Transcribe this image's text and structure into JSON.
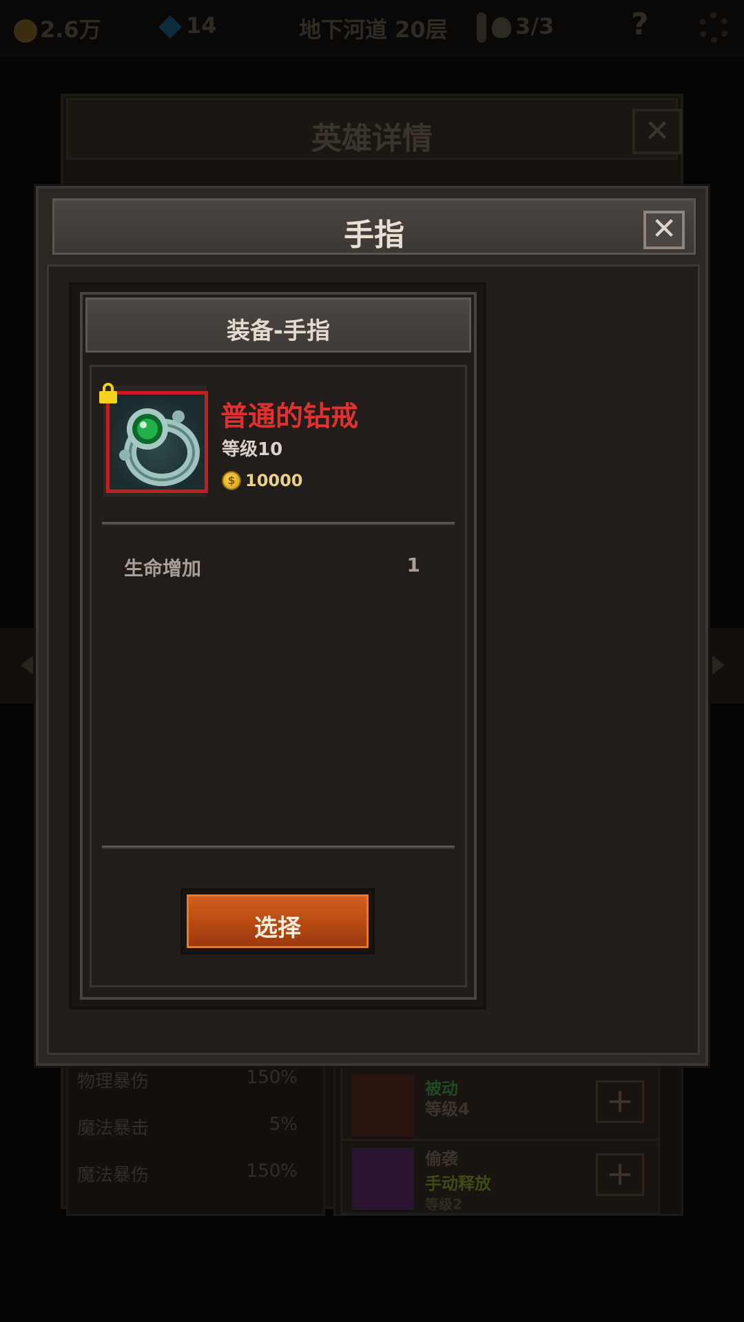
{
  "topbar": {
    "gold": "2.6万",
    "gems": "14",
    "location": "地下河道 20层",
    "keys": "3/3",
    "help": "?"
  },
  "hero_details": {
    "title": "英雄详情",
    "close": "✕",
    "stats": [
      {
        "label": "物理暴伤",
        "value": "150%"
      },
      {
        "label": "魔法暴击",
        "value": "5%"
      },
      {
        "label": "魔法暴伤",
        "value": "150%"
      }
    ],
    "skills": [
      {
        "type": "被动",
        "level": "等级4"
      },
      {
        "name": "偷袭",
        "type": "手动释放",
        "level": "等级2"
      }
    ]
  },
  "dialog": {
    "title": "手指",
    "close": "✕"
  },
  "equip": {
    "header": "装备-手指",
    "item_name": "普通的钻戒",
    "item_level": "等级10",
    "item_price": "10000",
    "attributes": [
      {
        "label": "生命增加",
        "value": "1"
      }
    ],
    "select_label": "选择"
  },
  "colors": {
    "item_name": "#e03030",
    "button": "#c0541a",
    "lock": "#f2d21b",
    "item_border": "#c12020"
  }
}
